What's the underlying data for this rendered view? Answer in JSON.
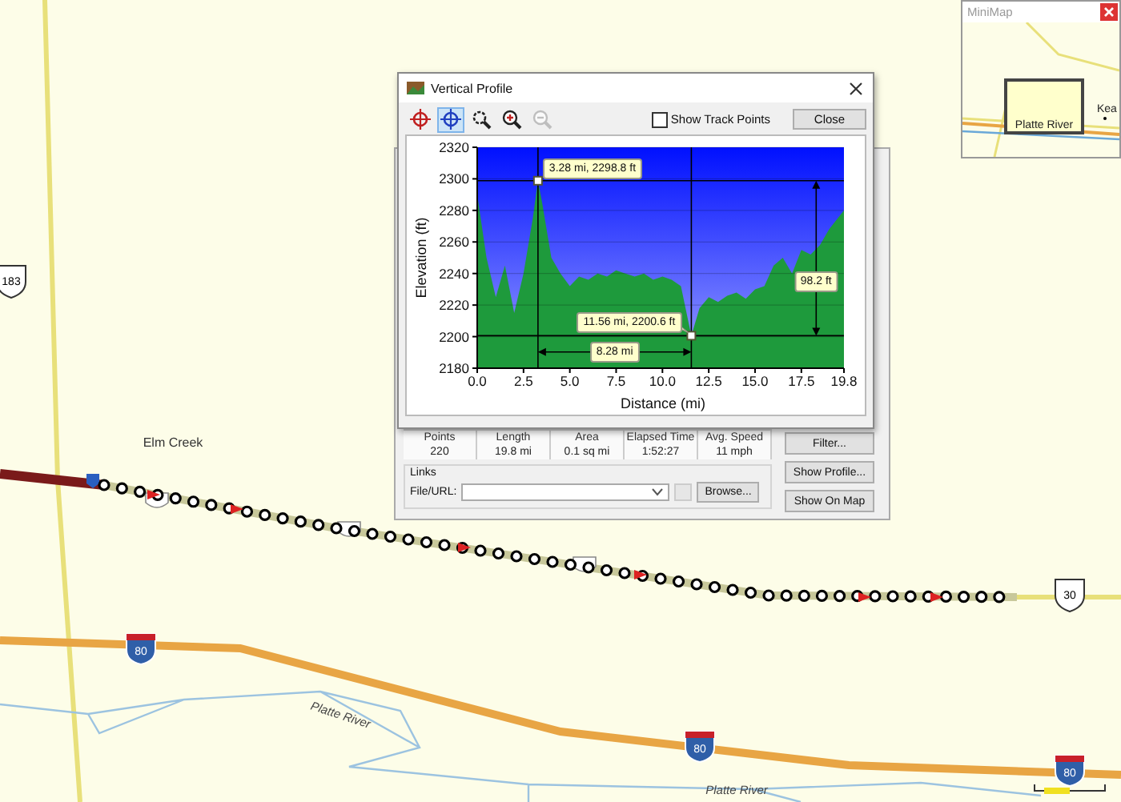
{
  "map": {
    "labels": [
      {
        "kind": "town",
        "text": "Elm Creek"
      },
      {
        "kind": "river",
        "text": "Platte River"
      },
      {
        "kind": "river",
        "text": "Platte River"
      }
    ],
    "shields": [
      {
        "kind": "us",
        "text": "183"
      },
      {
        "kind": "us",
        "text": "30"
      },
      {
        "kind": "interstate",
        "text": "80"
      },
      {
        "kind": "interstate",
        "text": "80"
      },
      {
        "kind": "interstate",
        "text": "80"
      }
    ]
  },
  "minimap": {
    "title": "MiniMap",
    "labels": [
      "Platte River",
      "Kea"
    ]
  },
  "properties": {
    "stats": {
      "columns": [
        "Points",
        "Length",
        "Area",
        "Elapsed Time",
        "Avg. Speed"
      ],
      "values": [
        "220",
        "19.8 mi",
        "0.1 sq mi",
        "1:52:27",
        "11 mph"
      ]
    },
    "links": {
      "title": "Links",
      "field_label": "File/URL:",
      "browse": "Browse..."
    },
    "buttons": [
      "Filter...",
      "Show Profile...",
      "Show On Map"
    ]
  },
  "profile": {
    "title": "Vertical Profile",
    "tools": [
      {
        "kind": "marker",
        "selected": false,
        "disabled": false
      },
      {
        "kind": "crosshair",
        "selected": true,
        "disabled": false
      },
      {
        "kind": "zoom-rect",
        "selected": false,
        "disabled": false
      },
      {
        "kind": "zoom-in",
        "selected": false,
        "disabled": false
      },
      {
        "kind": "zoom-out",
        "selected": false,
        "disabled": true
      }
    ],
    "show_track_points": {
      "label": "Show Track Points",
      "checked": false
    },
    "close": "Close",
    "chart_data": {
      "type": "area",
      "xlabel": "Distance (mi)",
      "ylabel": "Elevation (ft)",
      "grid": true,
      "x": [
        0,
        0.5,
        1,
        1.5,
        2,
        2.5,
        3,
        3.28,
        3.5,
        4,
        4.5,
        5,
        5.5,
        6,
        6.5,
        7,
        7.5,
        8,
        8.5,
        9,
        9.5,
        10,
        10.5,
        11,
        11.56,
        12,
        12.5,
        13,
        13.5,
        14,
        14.5,
        15,
        15.5,
        16,
        16.5,
        17,
        17.5,
        18,
        18.5,
        19,
        19.8
      ],
      "series": [
        {
          "color": "#1e9a3c",
          "values": [
            2290,
            2250,
            2225,
            2245,
            2215,
            2240,
            2275,
            2298.8,
            2285,
            2250,
            2240,
            2232,
            2238,
            2236,
            2240,
            2238,
            2242,
            2240,
            2238,
            2240,
            2236,
            2238,
            2236,
            2232,
            2200.6,
            2218,
            2225,
            2222,
            2226,
            2228,
            2224,
            2230,
            2232,
            2245,
            2250,
            2240,
            2255,
            2252,
            2258,
            2268,
            2280
          ]
        }
      ],
      "xlim": [
        0,
        19.8
      ],
      "ylim": [
        2180,
        2320
      ],
      "xticks": [
        {
          "value": 0,
          "label": "0.0"
        },
        {
          "value": 2.5,
          "label": "2.5"
        },
        {
          "value": 5,
          "label": "5.0"
        },
        {
          "value": 7.5,
          "label": "7.5"
        },
        {
          "value": 10,
          "label": "10.0"
        },
        {
          "value": 12.5,
          "label": "12.5"
        },
        {
          "value": 15,
          "label": "15.0"
        },
        {
          "value": 17.5,
          "label": "17.5"
        },
        {
          "value": 19.8,
          "label": "19.8"
        }
      ],
      "yticks": [
        2180,
        2200,
        2220,
        2240,
        2260,
        2280,
        2300,
        2320
      ],
      "annotations": [
        {
          "text": "3.28 mi, 2298.8 ft",
          "x": 3.28,
          "y": 2298.8
        },
        {
          "text": "11.56 mi, 2200.6 ft",
          "x": 11.56,
          "y": 2200.6
        },
        "8.28 mi",
        "98.2 ft"
      ]
    }
  }
}
